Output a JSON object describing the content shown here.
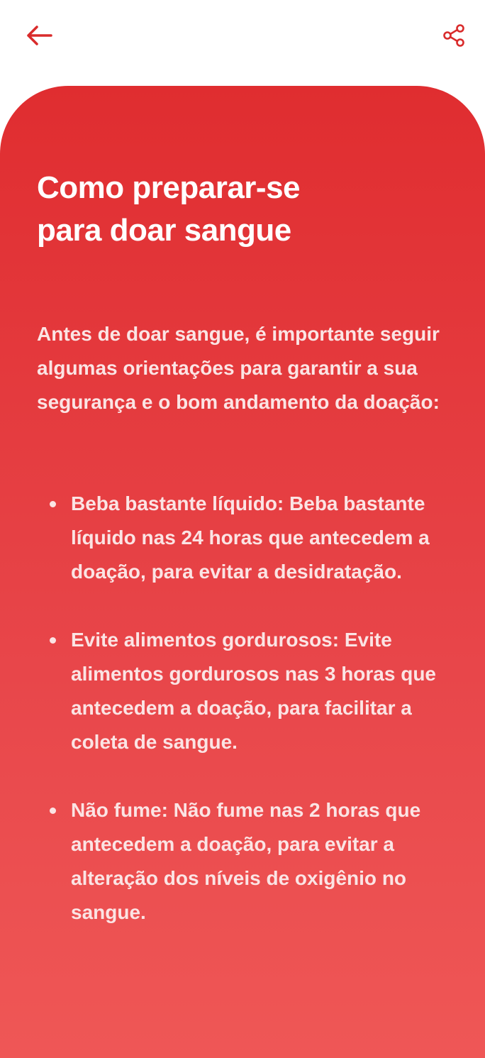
{
  "header": {
    "back_icon": "arrow-left-icon",
    "share_icon": "share-icon",
    "icon_color": "#d92b2b"
  },
  "article": {
    "title_lines": [
      "Como preparar-se",
      "para doar sangue"
    ],
    "intro": "Antes de doar sangue, é importante seguir algumas orientações para garantir a sua segurança e o bom andamento da doação:",
    "tips": [
      "Beba bastante líquido: Beba bastante líquido nas 24 horas que antecedem a doação, para evitar a desidratação.",
      "Evite alimentos gordurosos: Evite alimentos gordurosos nas 3 horas que antecedem a doação, para facilitar a coleta de sangue.",
      "Não fume: Não fume nas 2 horas que antecedem a doação, para evitar a alteração dos níveis de oxigênio no sangue."
    ]
  },
  "colors": {
    "card_top": "#e02d30",
    "card_bottom": "#ef5756",
    "text": "#ffffff"
  }
}
